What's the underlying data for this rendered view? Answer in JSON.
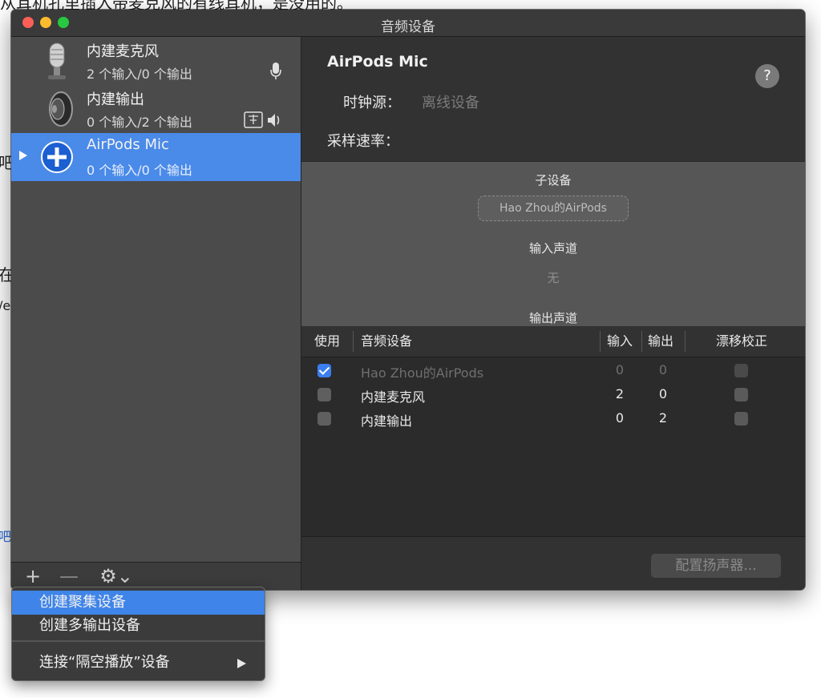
{
  "background": {
    "top_text": "从耳机孔里插入带麦克风的有线耳机，是没用的。",
    "left_fragments": [
      "吧",
      "在",
      "/e",
      "吧"
    ]
  },
  "window": {
    "title": "音频设备"
  },
  "sidebar": {
    "devices": [
      {
        "name": "内建麦克风",
        "io": "2 个输入/0 个输出",
        "icon": "microphone-icon",
        "badge": "mic-small-icon",
        "selected": false
      },
      {
        "name": "内建输出",
        "io": "0 个输入/2 个输出",
        "icon": "speaker-icon",
        "badge": "finder-speaker-icon",
        "selected": false
      },
      {
        "name": "AirPods Mic",
        "io": "0 个输入/0 个输出",
        "icon": "aggregate-plus-icon",
        "badge": "",
        "selected": true
      }
    ],
    "footer": {
      "add": "+",
      "remove": "—",
      "gear": "⚙⌄"
    }
  },
  "detail": {
    "title": "AirPods Mic",
    "help": "?",
    "clock_label": "时钟源：",
    "clock_value": "离线设备",
    "rate_label": "采样速率：",
    "subdevices_heading": "子设备",
    "subdevice_chip": "Hao Zhou的AirPods",
    "input_channels_heading": "输入声道",
    "input_channels_value": "无",
    "output_channels_heading": "输出声道"
  },
  "table": {
    "headers": {
      "use": "使用",
      "device": "音频设备",
      "in": "输入",
      "out": "输出",
      "drift": "漂移校正"
    },
    "rows": [
      {
        "checked": true,
        "name": "Hao Zhou的AirPods",
        "in": "0",
        "out": "0",
        "dim": true
      },
      {
        "checked": false,
        "name": "内建麦克风",
        "in": "2",
        "out": "0",
        "dim": false
      },
      {
        "checked": false,
        "name": "内建输出",
        "in": "0",
        "out": "2",
        "dim": false
      }
    ]
  },
  "config_button": "配置扬声器...",
  "menu": {
    "items": [
      {
        "label": "创建聚集设备",
        "highlighted": true
      },
      {
        "label": "创建多输出设备",
        "highlighted": false
      },
      {
        "label": "连接“隔空播放”设备",
        "highlighted": false,
        "submenu": true
      }
    ]
  },
  "colors": {
    "accent": "#4a8ae8",
    "menu_highlight": "#3f84e8",
    "window_bg": "#323232"
  }
}
